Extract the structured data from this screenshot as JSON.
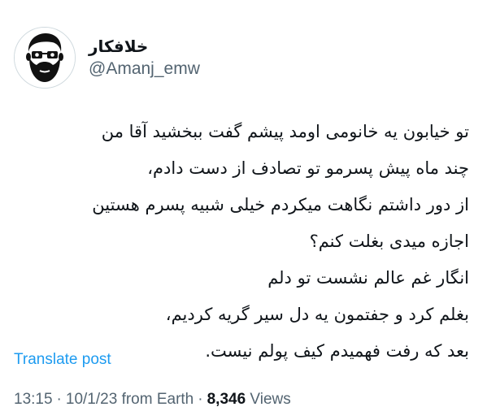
{
  "author": {
    "display_name": "خلافکار",
    "handle": "@Amanj_emw",
    "avatar_icon": "bearded-man-avatar-icon"
  },
  "tweet": {
    "lines": [
      "تو خیابون یه خانومی اومد پیشم گفت ببخشید آقا من",
      "چند ماه پیش پسرمو تو تصادف از دست دادم،",
      "از دور داشتم نگاهت میکردم خیلی شبیه پسرم هستین",
      "اجازه میدی بغلت کنم؟",
      "انگار غم عالم نشست تو دلم",
      "بغلم کرد و جفتمون یه دل سیر گریه کردیم،",
      "بعد که رفت فهمیدم کیف پولم نیست."
    ]
  },
  "translate_label": "Translate post",
  "meta": {
    "time": "13:15",
    "separator": "·",
    "date": "10/1/23",
    "source": "from Earth",
    "views_count": "8,346",
    "views_label": "Views"
  },
  "colors": {
    "text": "#0f1419",
    "secondary": "#536471",
    "link": "#1d9bf0",
    "background": "#ffffff"
  }
}
